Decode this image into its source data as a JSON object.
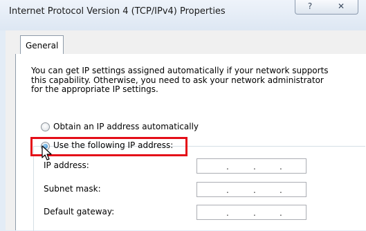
{
  "window": {
    "title": "Internet Protocol Version 4 (TCP/IPv4) Properties",
    "help_glyph": "?",
    "close_glyph": "✕"
  },
  "tabs": [
    {
      "label": "General",
      "selected": true
    }
  ],
  "general": {
    "description": [
      "You can get IP settings assigned automatically if your network supports",
      "this capability. Otherwise, you need to ask your network administrator",
      "for the appropriate IP settings."
    ],
    "option_auto": {
      "label": "Obtain an IP address automatically",
      "checked": false
    },
    "option_manual": {
      "label": "Use the following IP address:",
      "checked": true
    },
    "fields": [
      {
        "label": "IP address:",
        "separators": [
          ".",
          ".",
          "."
        ]
      },
      {
        "label": "Subnet mask:",
        "separators": [
          ".",
          ".",
          "."
        ]
      },
      {
        "label": "Default gateway:",
        "separators": [
          ".",
          ".",
          "."
        ]
      }
    ]
  },
  "annotation": {
    "highlight_color": "#e40d18"
  },
  "colors": {
    "titlebar": "#dde7f3",
    "panel": "#f0f0f0",
    "radio_checked": "#2a7ec0"
  },
  "icons": {
    "cursor": "mouse-pointer-icon"
  }
}
